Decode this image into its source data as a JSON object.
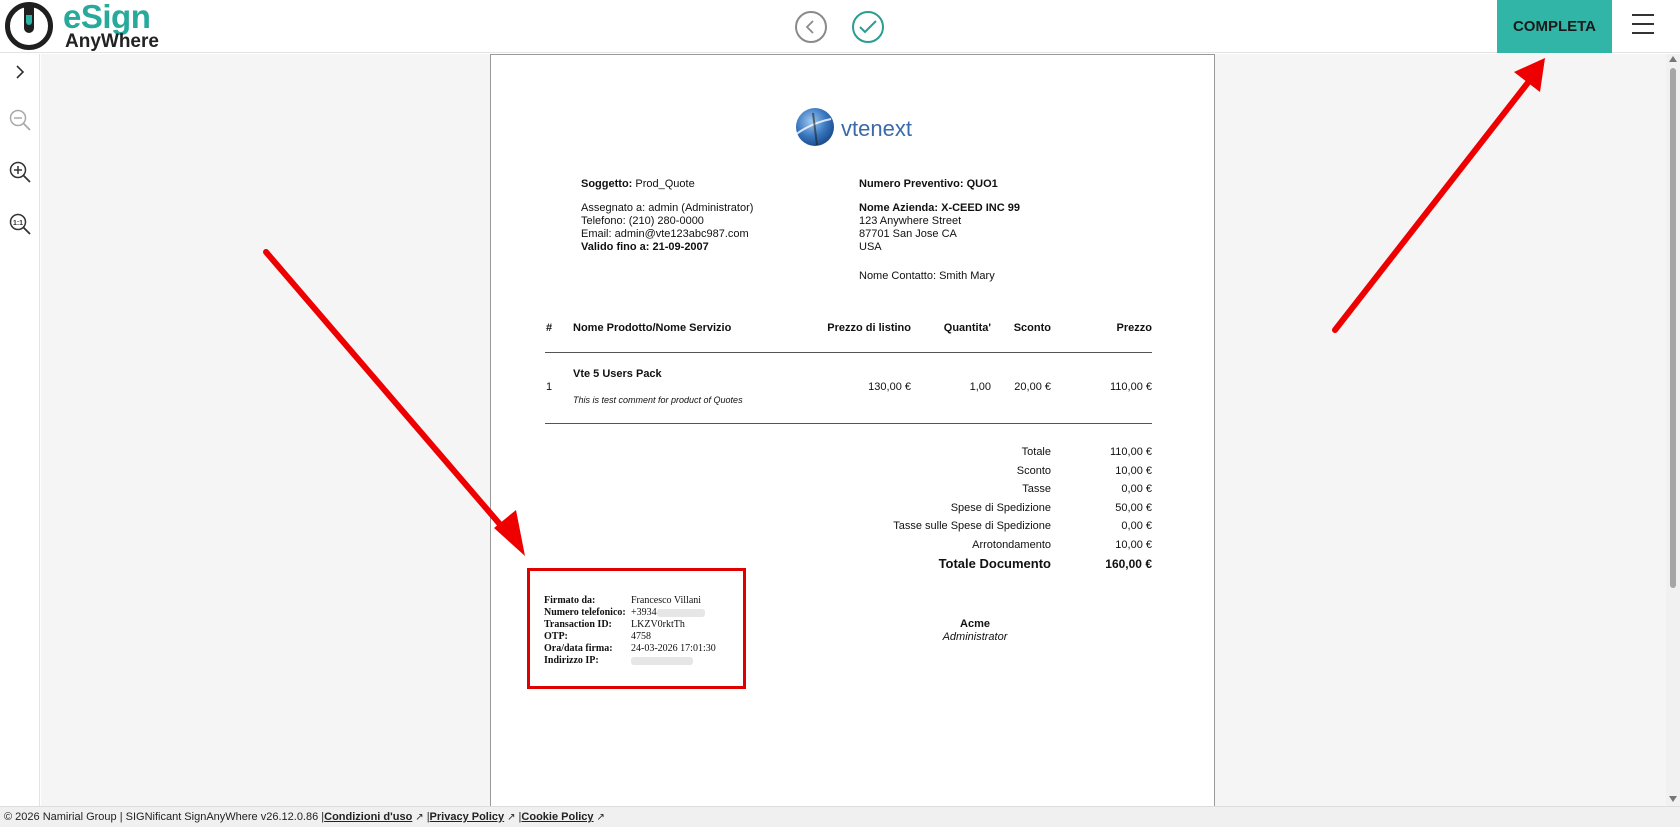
{
  "brand": {
    "name_main": "eSign",
    "name_sub": "AnyWhere"
  },
  "toolbar": {
    "complete_label": "COMPLETA"
  },
  "document": {
    "logo_text": "vtenext",
    "subject_label": "Soggetto:",
    "subject_value": "Prod_Quote",
    "quote_number_label": "Numero Preventivo:",
    "quote_number_value": "QUO1",
    "assigned": "Assegnato a: admin (Administrator)",
    "phone": "Telefono: (210) 280-0000",
    "email": "Email: admin@vte123abc987.com",
    "valid_until_label": "Valido fino a:",
    "valid_until_value": "21-09-2007",
    "company_label": "Nome Azienda:",
    "company_value": "X-CEED INC 99",
    "address1": "123 Anywhere Street",
    "address2": "87701 San Jose CA",
    "address3": "USA",
    "contact": "Nome Contatto: Smith Mary",
    "table_headers": [
      "#",
      "Nome Prodotto/Nome Servizio",
      "Prezzo di listino",
      "Quantita'",
      "Sconto",
      "Prezzo"
    ],
    "item": {
      "num": "1",
      "name": "Vte 5 Users Pack",
      "comment": "This is test comment for product of Quotes",
      "list_price": "130,00 €",
      "qty": "1,00",
      "discount": "20,00 €",
      "price": "110,00 €"
    },
    "totals": [
      {
        "label": "Totale",
        "value": "110,00 €"
      },
      {
        "label": "Sconto",
        "value": "10,00 €"
      },
      {
        "label": "Tasse",
        "value": "0,00 €"
      },
      {
        "label": "Spese di Spedizione",
        "value": "50,00 €"
      },
      {
        "label": "Tasse sulle Spese di Spedizione",
        "value": "0,00 €"
      },
      {
        "label": "Arrotondamento",
        "value": "10,00 €"
      }
    ],
    "grand_total_label": "Totale Documento",
    "grand_total_value": "160,00 €",
    "signer_company": "Acme",
    "signer_role": "Administrator",
    "signature": {
      "signed_by_label": "Firmato da:",
      "signed_by_value": "Francesco Villani",
      "phone_label": "Numero telefonico:",
      "phone_value": "+3934",
      "txn_label": "Transaction ID:",
      "txn_value": "LKZV0rktTh",
      "otp_label": "OTP:",
      "otp_value": "4758",
      "datetime_label": "Ora/data firma:",
      "datetime_value": "24-03-2026 17:01:30",
      "ip_label": "Indirizzo IP:"
    }
  },
  "footer": {
    "copyright": "© 2026 Namirial Group | SIGNificant SignAnyWhere v26.12.0.86 |",
    "terms": "Condizioni d'uso",
    "privacy": "Privacy Policy",
    "cookie": "Cookie Policy"
  },
  "colors": {
    "accent": "#30b5a7",
    "annotation": "#e00000"
  }
}
